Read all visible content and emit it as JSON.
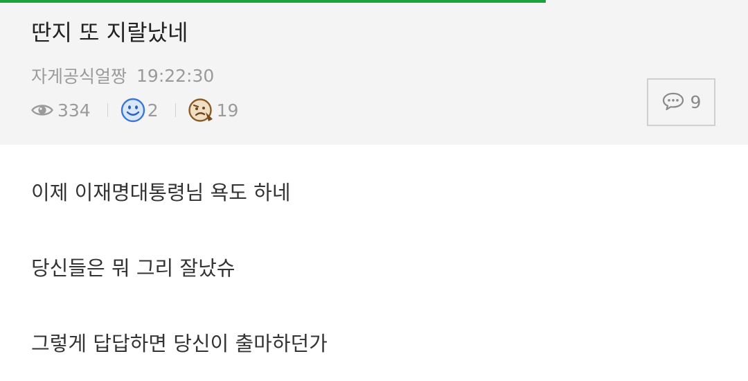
{
  "progress": {
    "fraction": 0.73,
    "color": "#19a33a"
  },
  "post": {
    "title": "딴지 또 지랄났네",
    "author": "자게공식얼짱",
    "time": "19:22:30",
    "views": "334",
    "likes": "2",
    "dislikes": "19",
    "comment_count": "9",
    "icons": {
      "views": "eye-icon",
      "likes": "smiley-icon",
      "dislikes": "frown-icon",
      "comments": "speech-bubble-icon"
    },
    "body": [
      "이제 이재명대통령님 욕도 하네",
      "당신들은 뭐 그리 잘났슈",
      "그렇게 답답하면 당신이 출마하던가"
    ]
  }
}
